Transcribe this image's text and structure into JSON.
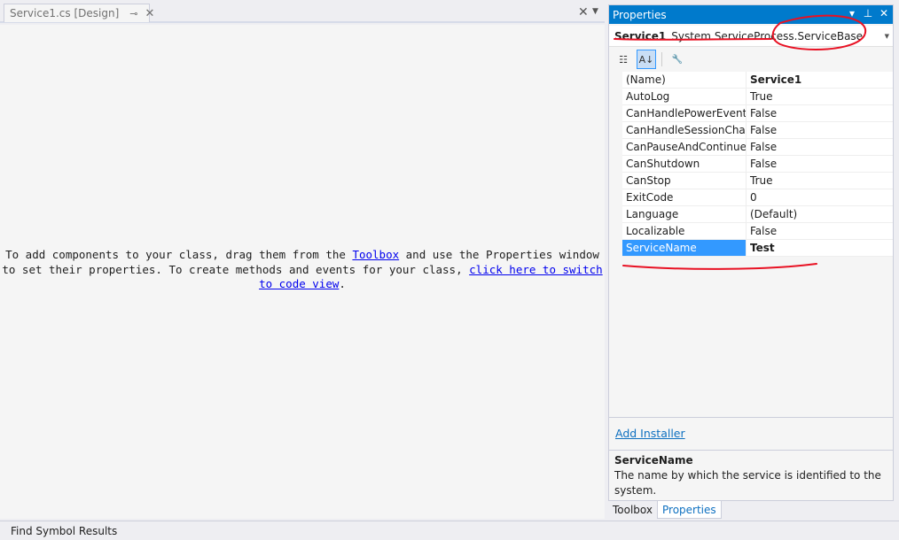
{
  "document": {
    "tab_title": "Service1.cs [Design]",
    "pin_glyph": "⊸",
    "close_glyph": "✕",
    "tabbar_close_glyph": "✕",
    "tabbar_dropdown_glyph": "▼",
    "message_line1_pre": "To add components to your class, drag them from the ",
    "toolbox_link": "Toolbox",
    "message_line1_post": " and use the Properties window",
    "message_line2_pre": "to set their properties. To create methods and events for your class, ",
    "code_link_part1": "click here to switch",
    "code_link_part2": "to code view",
    "message_end": "."
  },
  "properties": {
    "title": "Properties",
    "title_icons": {
      "dropdown": "▾",
      "pin": "⊥",
      "close": "✕"
    },
    "object_name": "Service1",
    "object_type": "System.ServiceProcess.ServiceBase",
    "object_dropdown_glyph": "▼",
    "toolbar": {
      "categorized_icon": "categorized-icon",
      "alphabetical_icon": "alphabetical-icon",
      "property_pages_icon": "wrench-icon",
      "categorized_glyph": "☷",
      "alphabetical_glyph": "A↓",
      "wrench_glyph": "🔧"
    },
    "rows": [
      {
        "name": "(Name)",
        "value": "Service1"
      },
      {
        "name": "AutoLog",
        "value": "True"
      },
      {
        "name": "CanHandlePowerEvent",
        "value": "False"
      },
      {
        "name": "CanHandleSessionChangeEvent",
        "value": "False"
      },
      {
        "name": "CanPauseAndContinue",
        "value": "False"
      },
      {
        "name": "CanShutdown",
        "value": "False"
      },
      {
        "name": "CanStop",
        "value": "True"
      },
      {
        "name": "ExitCode",
        "value": "0"
      },
      {
        "name": "Language",
        "value": "(Default)"
      },
      {
        "name": "Localizable",
        "value": "False"
      },
      {
        "name": "ServiceName",
        "value": "Test"
      }
    ],
    "command_link": "Add Installer",
    "description_title": "ServiceName",
    "description_text": "The name by which the service is identified to the system."
  },
  "pane_tabs": [
    {
      "label": "Toolbox"
    },
    {
      "label": "Properties"
    }
  ],
  "bottom_bar": {
    "tab": "Find Symbol Results"
  },
  "colors": {
    "accent": "#007acc",
    "selection": "#3399ff",
    "annotation": "#e81123",
    "link": "#0000ee"
  }
}
